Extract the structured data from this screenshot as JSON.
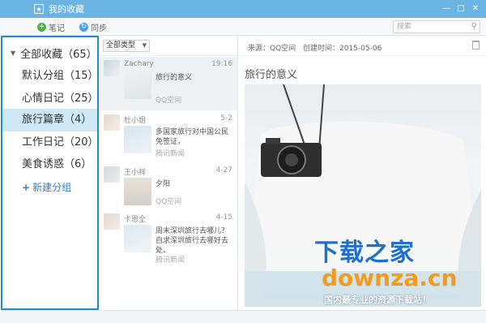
{
  "window": {
    "title": "我的收藏",
    "controls": [
      "—",
      "□",
      "✕"
    ]
  },
  "toolbar": {
    "note_label": "笔记",
    "sync_label": "同步",
    "search_placeholder": "搜索"
  },
  "sidebar": {
    "all": "全部收藏（65）",
    "items": [
      {
        "label": "默认分组（15）"
      },
      {
        "label": "心情日记（25）"
      },
      {
        "label": "旅行篇章（4）",
        "active": true
      },
      {
        "label": "工作日记（20）"
      },
      {
        "label": "美食诱惑（6）"
      }
    ],
    "new_group": "新建分组"
  },
  "list": {
    "type_filter": "全部类型",
    "notes": [
      {
        "author": "Zachary",
        "date": "19:16",
        "title": "旅行的意义",
        "source": "QQ空间"
      },
      {
        "author": "杜小姐",
        "date": "5-2",
        "title": "多国家旅行对中国公民免签证，",
        "source": "腾讯新闻"
      },
      {
        "author": "王小祥",
        "date": "4-27",
        "title": "夕阳",
        "source": "QQ空间"
      },
      {
        "author": "卡恩全",
        "date": "4-15",
        "title": "周末深圳旅行去哪儿？自求深圳旅行去哪好去处。",
        "source": "腾讯新闻"
      }
    ]
  },
  "detail": {
    "source": "来源：QQ空间",
    "created": "创建时间：2015-05-06",
    "title": "旅行的意义"
  },
  "watermark": {
    "line1": "下载之家",
    "line2": "downza.cn",
    "line3": "国内最专业的资源下载站！"
  },
  "colors": {
    "accent": "#1f8bd1",
    "titlebar": "#6ab3e3",
    "active_row": "#cfe8f7"
  }
}
